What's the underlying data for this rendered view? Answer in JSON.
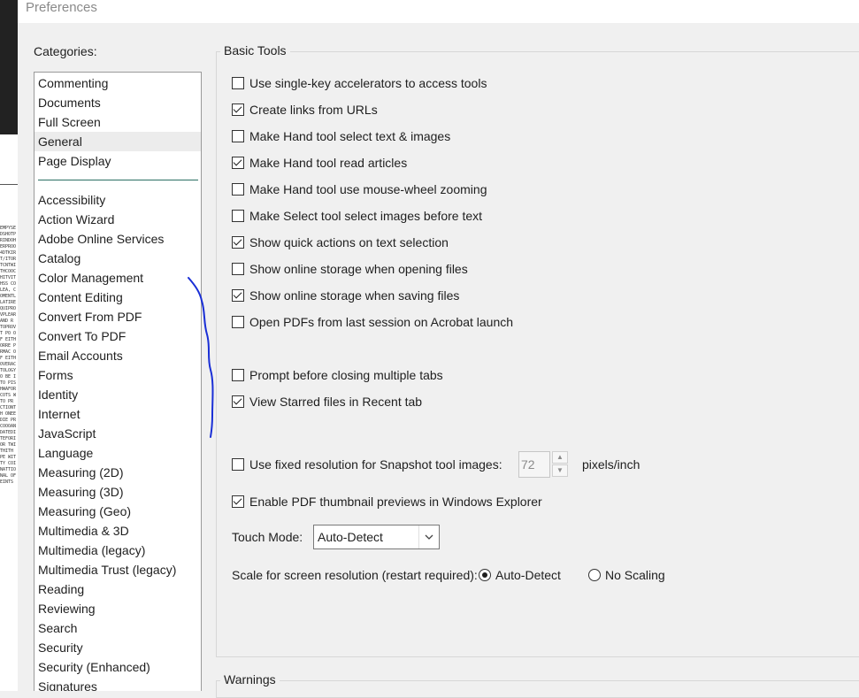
{
  "window": {
    "title": "Preferences"
  },
  "categories": {
    "label": "Categories:",
    "top_items": [
      "Commenting",
      "Documents",
      "Full Screen",
      "General",
      "Page Display"
    ],
    "selected": "General",
    "items": [
      "Accessibility",
      "Action Wizard",
      "Adobe Online Services",
      "Catalog",
      "Color Management",
      "Content Editing",
      "Convert From PDF",
      "Convert To PDF",
      "Email Accounts",
      "Forms",
      "Identity",
      "Internet",
      "JavaScript",
      "Language",
      "Measuring (2D)",
      "Measuring (3D)",
      "Measuring (Geo)",
      "Multimedia & 3D",
      "Multimedia (legacy)",
      "Multimedia Trust (legacy)",
      "Reading",
      "Reviewing",
      "Search",
      "Security",
      "Security (Enhanced)",
      "Signatures"
    ]
  },
  "basic_tools": {
    "legend": "Basic Tools",
    "options": [
      {
        "label": "Use single-key accelerators to access tools",
        "checked": false
      },
      {
        "label": "Create links from URLs",
        "checked": true
      },
      {
        "label": "Make Hand tool select text & images",
        "checked": false
      },
      {
        "label": "Make Hand tool read articles",
        "checked": true
      },
      {
        "label": "Make Hand tool use mouse-wheel zooming",
        "checked": false
      },
      {
        "label": "Make Select tool select images before text",
        "checked": false
      },
      {
        "label": "Show quick actions on text selection",
        "checked": true
      },
      {
        "label": "Show online storage when opening files",
        "checked": false
      },
      {
        "label": "Show online storage when saving files",
        "checked": true
      },
      {
        "label": "Open PDFs from last session on Acrobat launch",
        "checked": false
      },
      {
        "label": "Prompt before closing multiple tabs",
        "checked": false
      },
      {
        "label": "View Starred files in Recent tab",
        "checked": true
      },
      {
        "label": "Use fixed resolution for Snapshot tool images:",
        "checked": false
      },
      {
        "label": "Enable PDF thumbnail previews in Windows Explorer",
        "checked": true
      }
    ],
    "snapshot_resolution": {
      "value": "72",
      "units": "pixels/inch"
    },
    "touch_mode": {
      "label": "Touch Mode:",
      "value": "Auto-Detect"
    },
    "scale": {
      "label": "Scale for screen resolution (restart required):",
      "options": [
        {
          "label": "Auto-Detect",
          "selected": true
        },
        {
          "label": "No Scaling",
          "selected": false
        }
      ]
    }
  },
  "warnings": {
    "legend": "Warnings"
  },
  "colors": {
    "accent_divider": "#2b6f63",
    "annotation_ink": "#1a2fd6",
    "selected_row": "#ececec"
  },
  "icons": {
    "spin_up": "chevron-up-icon",
    "spin_down": "chevron-down-icon",
    "dropdown": "chevron-down-icon"
  }
}
